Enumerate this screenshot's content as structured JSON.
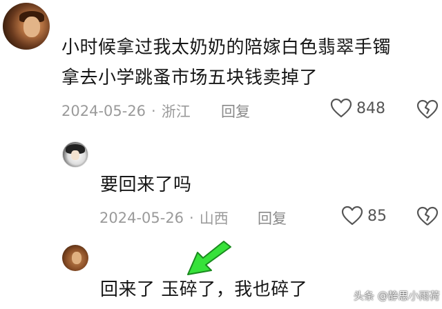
{
  "comment": {
    "line1": "小时候拿过我太奶奶的陪嫁白色翡翠手镯",
    "line2": "拿去小学跳蚤市场五块钱卖掉了",
    "date": "2024-05-26",
    "sep": "·",
    "location": "浙江",
    "reply_label": "回复",
    "likes": "848"
  },
  "replies": [
    {
      "text": "要回来了吗",
      "date": "2024-05-26",
      "sep": "·",
      "location": "山西",
      "reply_label": "回复",
      "likes": "85"
    },
    {
      "text": "回来了 玉碎了，我也碎了"
    }
  ],
  "watermark": "头条 @静思小雨荷",
  "colors": {
    "arrow_fill": "#37e23a",
    "arrow_stroke": "#1a8a1e",
    "meta_text": "#9a9a9a",
    "icon_stroke": "#555555"
  },
  "icons": {
    "like": "heart-icon",
    "dislike": "broken-heart-icon",
    "annotation": "green-arrow-icon"
  }
}
